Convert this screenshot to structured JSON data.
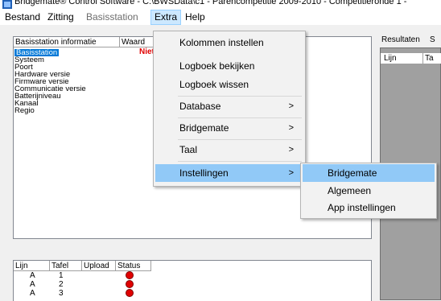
{
  "titlebar": {
    "title": "Bridgemate® Control Software - C:\\BWSData\\c1 - Parencompetitie 2009-2010 - Competitieronde 1 -"
  },
  "menubar": {
    "items": [
      {
        "label": "Bestand"
      },
      {
        "label": "Zitting"
      },
      {
        "label": "Basisstation"
      },
      {
        "label": "Extra"
      },
      {
        "label": "Help"
      }
    ]
  },
  "info_panel": {
    "headers": [
      "Basisstation informatie",
      "Waard"
    ],
    "rows": [
      "Basisstation",
      "Systeem",
      "Poort",
      "Hardware versie",
      "Firmware versie",
      "Communicatie versie",
      "Batterijniveau",
      "Kanaal",
      "Regio"
    ],
    "value": "Niet a"
  },
  "results_panel": {
    "tab": "Resultaten",
    "tab2": "S",
    "headers": [
      "Lijn",
      "Ta"
    ]
  },
  "status_panel": {
    "headers": [
      "Lijn",
      "Tafel",
      "Upload",
      "Status"
    ],
    "rows": [
      {
        "lijn": "A",
        "tafel": "1"
      },
      {
        "lijn": "A",
        "tafel": "2"
      },
      {
        "lijn": "A",
        "tafel": "3"
      }
    ],
    "status_color": "#e00000"
  },
  "extra_menu": {
    "items": [
      {
        "label": "Kolommen instellen",
        "submenu": false
      },
      {
        "label": "Logboek bekijken",
        "submenu": false
      },
      {
        "label": "Logboek wissen",
        "submenu": false
      },
      {
        "label": "Database",
        "submenu": true
      },
      {
        "label": "Bridgemate",
        "submenu": true
      },
      {
        "label": "Taal",
        "submenu": true
      },
      {
        "label": "Instellingen",
        "submenu": true
      }
    ],
    "arrow": ">"
  },
  "instellingen_submenu": {
    "items": [
      "Bridgemate",
      "Algemeen",
      "App instellingen"
    ]
  },
  "colors": {
    "highlight": "#91c9f7",
    "selection": "#0078d7",
    "menu_active": "#cce8ff",
    "dark_panel": "#a0a0a0"
  }
}
